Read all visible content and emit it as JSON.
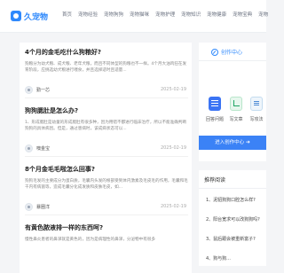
{
  "header": {
    "logo_text": "久宠物",
    "nav": [
      "首页",
      "宠物经验",
      "宠物狗狗",
      "宠物猫咪",
      "宠物护理",
      "宠物知识",
      "宠物健康",
      "宠物宝典",
      "宠物"
    ]
  },
  "articles": [
    {
      "title": "4个月的金毛吃什么狗粮好?",
      "summary": "狗粮分为幼犬粮、成犬粮、老年犬粮，而且不同体型的狗粮也不一样。4个月大油鸡狂在发育阶段，应挑选幼犬粮进行喂食，并且选择适时且适量...",
      "author": "勤一芯",
      "date": "2025-02-19"
    },
    {
      "title": "狗狗腮肚是怎么办?",
      "summary": "1、形成腮肚是幼童的形成腮肚有很多种，因为用错不都进行临床治疗，所以不能准确判断狗狗的具体病因。但是，通过患病时，该成病状态可以...",
      "author": "噢金宝",
      "date": "2025-02-19"
    },
    {
      "title": "8个月金毛毛啦怎么回事?",
      "summary": "狗狗毛发的主要成分为蛋白质，毛囊内头发的根部受到体内激素及毛皮毛的作用，毛囊和毛干内有病菌等，造成毛囊分化成发质和皮肤毛皮，如...",
      "author": "暴圈洋",
      "date": "2025-02-19"
    },
    {
      "title": "有黄色脓液排一样的东西呵?",
      "summary": "慢性鼻炎患者的鼻涕就是黄色的，因为是病理性的鼻涕，分泌物中有很多",
      "author": "",
      "date": ""
    }
  ],
  "sidebar": {
    "creator_title": "创作中心",
    "tools": [
      "回答问题",
      "写文章",
      "写攻法"
    ],
    "enter_label": "进入创作中心",
    "enter_arrow": "➜",
    "recommend_title": "推荐阅读",
    "recommend_items": [
      "1、泥貂狗狗口腔怎么样?",
      "2、阳台宽求可以改狗狗吗?",
      "3、鼠后跟会被重新富子?",
      "4、狗与狗..."
    ]
  },
  "colors": {
    "accent": "#2f89fc",
    "button": "#3b82f6"
  }
}
